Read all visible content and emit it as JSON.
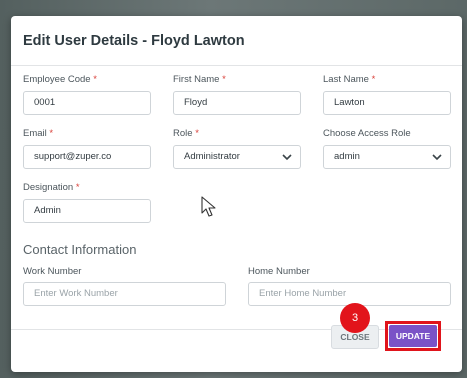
{
  "modal": {
    "title": "Edit User Details - Floyd Lawton"
  },
  "fields": {
    "employee_code": {
      "label": "Employee Code",
      "required": "*",
      "value": "0001"
    },
    "first_name": {
      "label": "First Name",
      "required": "*",
      "value": "Floyd"
    },
    "last_name": {
      "label": "Last Name",
      "required": "*",
      "value": "Lawton"
    },
    "email": {
      "label": "Email",
      "required": "*",
      "value": "support@zuper.co"
    },
    "role": {
      "label": "Role",
      "required": "*",
      "value": "Administrator"
    },
    "access_role": {
      "label": "Choose Access Role",
      "value": "admin"
    },
    "designation": {
      "label": "Designation",
      "required": "*",
      "value": "Admin"
    }
  },
  "contact": {
    "heading": "Contact Information",
    "work_number": {
      "label": "Work Number",
      "placeholder": "Enter Work Number"
    },
    "home_number": {
      "label": "Home Number",
      "placeholder": "Enter Home Number"
    }
  },
  "footer": {
    "close_label": "CLOSE",
    "update_label": "UPDATE"
  },
  "annotation": {
    "step_number": "3",
    "highlight_color": "#e0141b"
  },
  "colors": {
    "primary": "#7a52c7",
    "required": "#d9413a"
  },
  "icons": {
    "select_chevron": "chevron-down-icon",
    "cursor": "mouse-pointer-icon"
  }
}
